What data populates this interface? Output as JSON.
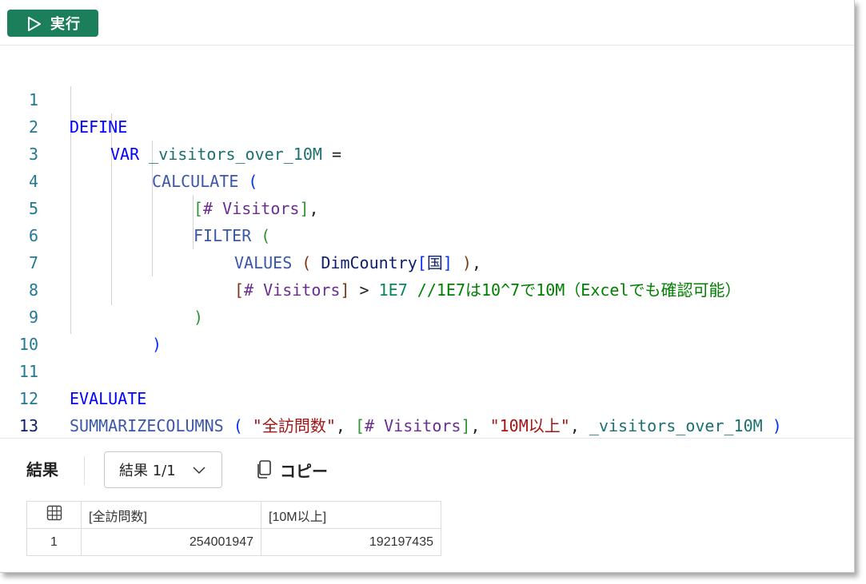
{
  "toolbar": {
    "run_label": "実行"
  },
  "editor": {
    "line_numbers": [
      "1",
      "2",
      "3",
      "4",
      "5",
      "6",
      "7",
      "8",
      "9",
      "10",
      "11",
      "12",
      "13"
    ],
    "tokens": {
      "define": "DEFINE",
      "var": "VAR",
      "var_name": "_visitors_over_10M",
      "eq": " =",
      "calculate": "CALCULATE",
      "open_paren": " (",
      "lbr": "[",
      "rbr": "]",
      "measure": "# Visitors",
      "comma": ",",
      "filter": "FILTER",
      "values": "VALUES",
      "lp_sp": " ( ",
      "table": "DimCountry",
      "column": "国",
      "rp_sp": " )",
      "gt": " > ",
      "sci": "1E7",
      "comment": " //1E7は10^7で10M（Excelでも確認可能）",
      "close_paren": ")",
      "evaluate": "EVALUATE",
      "summarize": "SUMMARIZECOLUMNS",
      "str1": "\"全訪問数\"",
      "comma_sp": ", ",
      "str2": "\"10M以上\"",
      "final_close": " )"
    }
  },
  "results": {
    "title": "結果",
    "selector": "結果 1/1",
    "copy_label": "コピー",
    "columns": [
      "[全訪問数]",
      "[10M以上]"
    ],
    "rows": [
      {
        "index": "1",
        "values": [
          "254001947",
          "192197435"
        ]
      }
    ]
  }
}
